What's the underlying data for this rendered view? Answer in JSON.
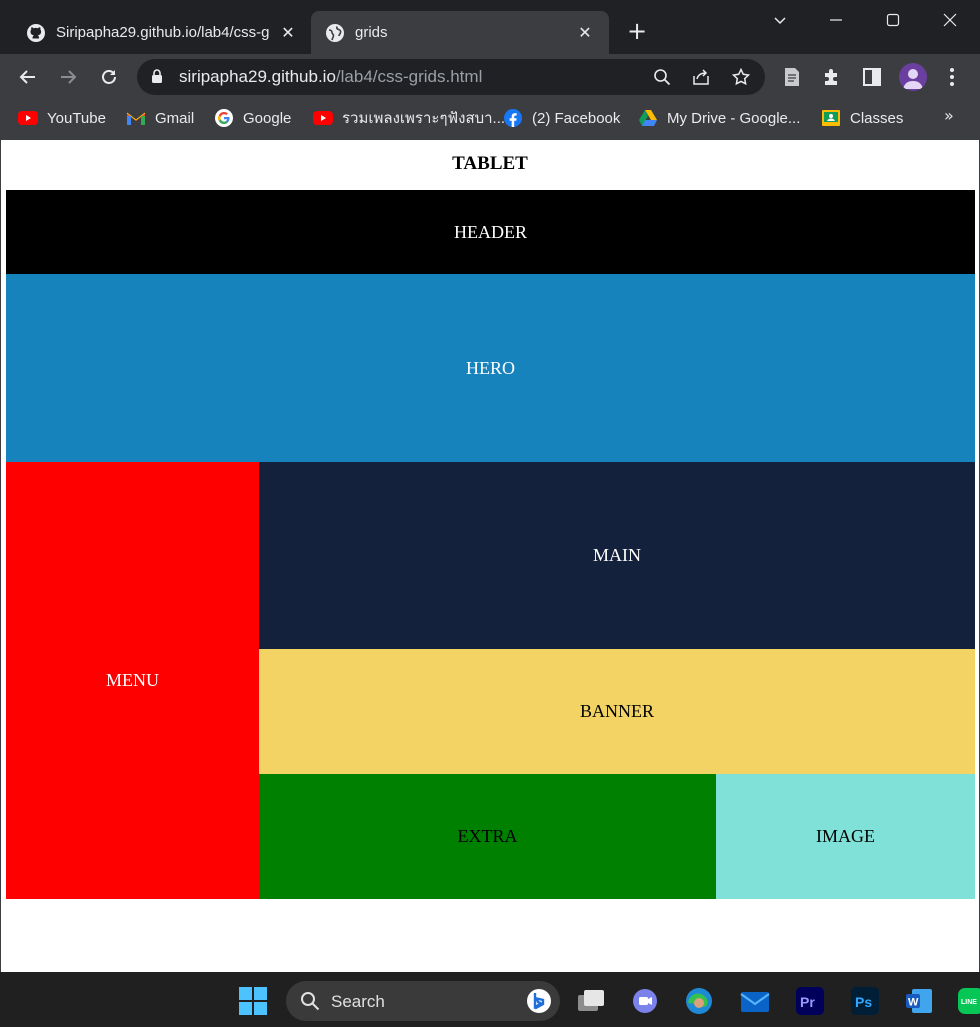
{
  "tabs": [
    {
      "title": "Siripapha29.github.io/lab4/css-g",
      "icon": "github-icon",
      "active": false
    },
    {
      "title": "grids",
      "icon": "globe-icon",
      "active": true
    }
  ],
  "address_bar": {
    "host": "siripapha29.github.io",
    "path": "/lab4/css-grids.html"
  },
  "bookmarks": [
    {
      "label": "YouTube",
      "icon": "youtube-icon"
    },
    {
      "label": "Gmail",
      "icon": "gmail-icon"
    },
    {
      "label": "Google",
      "icon": "google-icon"
    },
    {
      "label": "รวมเพลงเพราะๆฟังสบา...",
      "icon": "youtube-icon"
    },
    {
      "label": "(2) Facebook",
      "icon": "facebook-icon"
    },
    {
      "label": "My Drive - Google...",
      "icon": "drive-icon"
    },
    {
      "label": "Classes",
      "icon": "classroom-icon"
    }
  ],
  "page": {
    "heading": "TABLET",
    "grid": {
      "header": {
        "label": "HEADER",
        "bg": "#000000",
        "fg": "#ffffff"
      },
      "hero": {
        "label": "HERO",
        "bg": "#1783bc",
        "fg": "#ffffff"
      },
      "menu": {
        "label": "MENU",
        "bg": "#ff0000",
        "fg": "#ffffff"
      },
      "main": {
        "label": "MAIN",
        "bg": "#14213d",
        "fg": "#ffffff"
      },
      "banner": {
        "label": "BANNER",
        "bg": "#f2d364",
        "fg": "#000000"
      },
      "extra": {
        "label": "EXTRA",
        "bg": "#008000",
        "fg": "#000000"
      },
      "image": {
        "label": "IMAGE",
        "bg": "#80e1d9",
        "fg": "#000000"
      }
    }
  },
  "taskbar": {
    "search_label": "Search"
  }
}
